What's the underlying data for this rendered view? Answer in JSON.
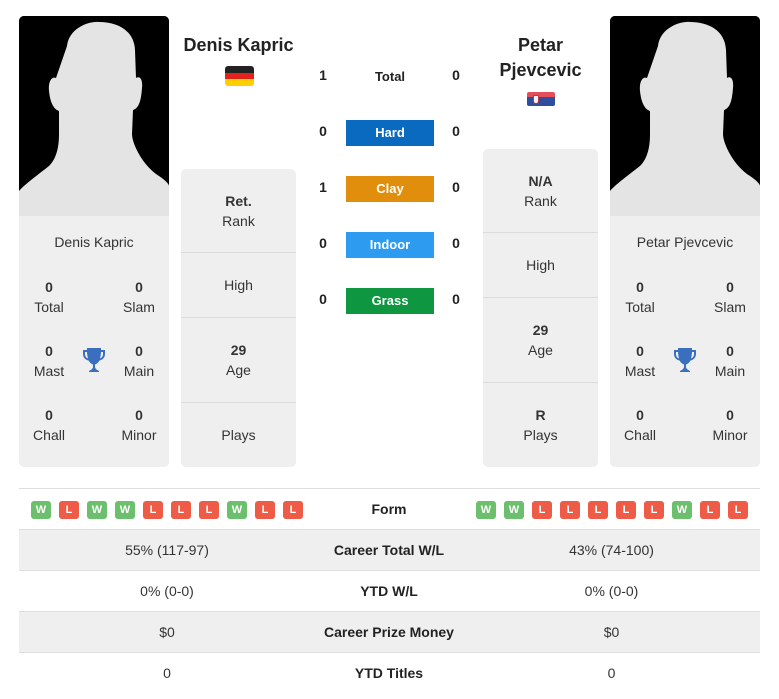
{
  "colors": {
    "hard": "#0a6abf",
    "clay": "#e08e0b",
    "indoor": "#2d9cf0",
    "grass": "#0e9640",
    "win": "#6cbf6c",
    "loss": "#ee5b47",
    "trophy": "#3a6fbf"
  },
  "player1": {
    "name": "Denis Kapric",
    "flag": "germany-flag",
    "card_name": "Denis Kapric",
    "titles": {
      "total": {
        "value": "0",
        "label": "Total"
      },
      "slam": {
        "value": "0",
        "label": "Slam"
      },
      "mast": {
        "value": "0",
        "label": "Mast"
      },
      "main": {
        "value": "0",
        "label": "Main"
      },
      "chall": {
        "value": "0",
        "label": "Chall"
      },
      "minor": {
        "value": "0",
        "label": "Minor"
      }
    },
    "stats": {
      "rank": {
        "value": "Ret.",
        "label": "Rank"
      },
      "high": {
        "value": "",
        "label": "High"
      },
      "age": {
        "value": "29",
        "label": "Age"
      },
      "plays": {
        "value": "",
        "label": "Plays"
      }
    },
    "form": [
      "W",
      "L",
      "W",
      "W",
      "L",
      "L",
      "L",
      "W",
      "L",
      "L"
    ]
  },
  "player2": {
    "name": "Petar Pjevcevic",
    "name_line1": "Petar",
    "name_line2": "Pjevcevic",
    "flag": "serbia-flag",
    "card_name": "Petar Pjevcevic",
    "titles": {
      "total": {
        "value": "0",
        "label": "Total"
      },
      "slam": {
        "value": "0",
        "label": "Slam"
      },
      "mast": {
        "value": "0",
        "label": "Mast"
      },
      "main": {
        "value": "0",
        "label": "Main"
      },
      "chall": {
        "value": "0",
        "label": "Chall"
      },
      "minor": {
        "value": "0",
        "label": "Minor"
      }
    },
    "stats": {
      "rank": {
        "value": "N/A",
        "label": "Rank"
      },
      "high": {
        "value": "",
        "label": "High"
      },
      "age": {
        "value": "29",
        "label": "Age"
      },
      "plays": {
        "value": "R",
        "label": "Plays"
      }
    },
    "form": [
      "W",
      "W",
      "L",
      "L",
      "L",
      "L",
      "L",
      "W",
      "L",
      "L"
    ]
  },
  "h2h": {
    "total": {
      "label": "Total",
      "p1": "1",
      "p2": "0"
    },
    "hard": {
      "label": "Hard",
      "p1": "0",
      "p2": "0"
    },
    "clay": {
      "label": "Clay",
      "p1": "1",
      "p2": "0"
    },
    "indoor": {
      "label": "Indoor",
      "p1": "0",
      "p2": "0"
    },
    "grass": {
      "label": "Grass",
      "p1": "0",
      "p2": "0"
    }
  },
  "table": {
    "form_label": "Form",
    "rows": [
      {
        "label": "Career Total W/L",
        "p1": "55% (117-97)",
        "p2": "43% (74-100)"
      },
      {
        "label": "YTD W/L",
        "p1": "0% (0-0)",
        "p2": "0% (0-0)"
      },
      {
        "label": "Career Prize Money",
        "p1": "$0",
        "p2": "$0"
      },
      {
        "label": "YTD Titles",
        "p1": "0",
        "p2": "0"
      }
    ]
  }
}
